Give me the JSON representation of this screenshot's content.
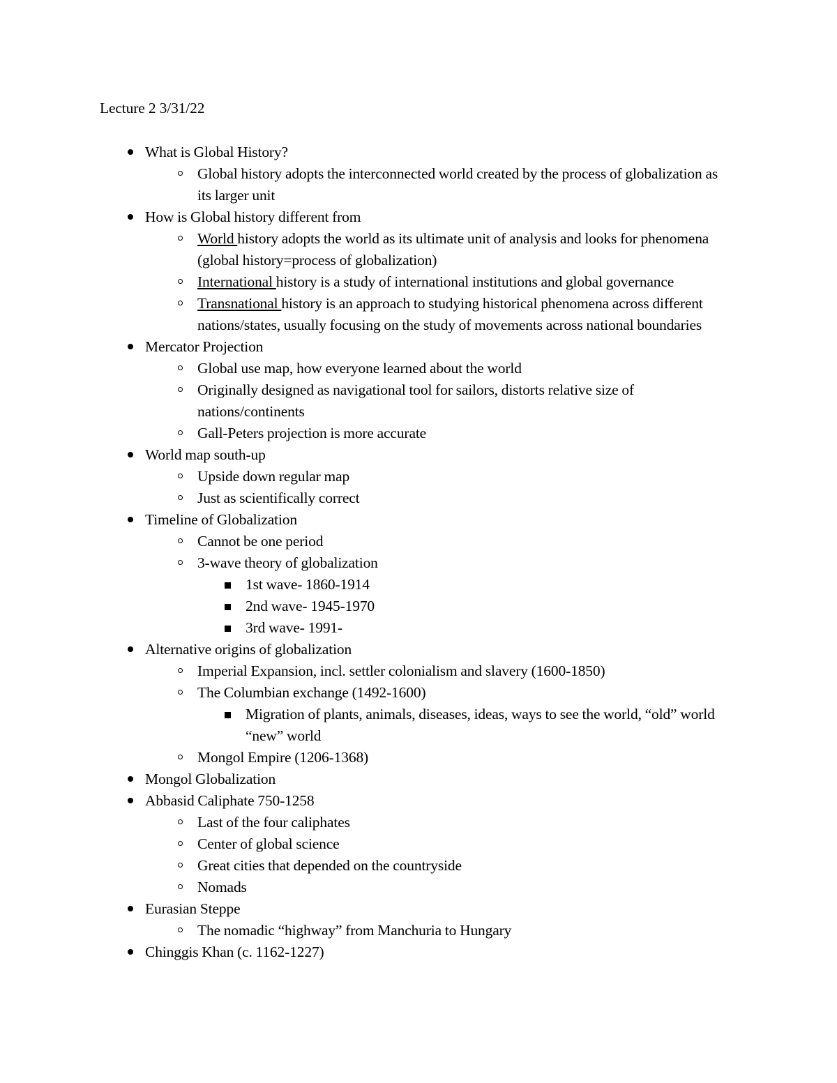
{
  "document": {
    "header": "Lecture 2 3/31/22",
    "outline": [
      {
        "level": 1,
        "bullet": "disc-bullet",
        "text": "What is Global History?"
      },
      {
        "level": 2,
        "bullet": "circle-bullet",
        "text": "Global history adopts the interconnected world created by the process of globalization as its larger unit"
      },
      {
        "level": 1,
        "bullet": "disc-bullet",
        "text": "How is Global history different from"
      },
      {
        "level": 2,
        "bullet": "circle-bullet",
        "underline_prefix": "World ",
        "text": "history adopts the world as its ultimate unit of analysis and looks for phenomena (global history=process of globalization)"
      },
      {
        "level": 2,
        "bullet": "circle-bullet",
        "underline_prefix": "International ",
        "text": "history is a study of international institutions and global governance"
      },
      {
        "level": 2,
        "bullet": "circle-bullet",
        "underline_prefix": "Transnational ",
        "text": "history is an approach to studying historical phenomena across different nations/states, usually focusing on the study of movements across national boundaries"
      },
      {
        "level": 1,
        "bullet": "disc-bullet",
        "text": "Mercator Projection"
      },
      {
        "level": 2,
        "bullet": "circle-bullet",
        "text": "Global use map, how everyone learned about the world"
      },
      {
        "level": 2,
        "bullet": "circle-bullet",
        "text": "Originally designed as navigational tool for sailors, distorts relative size of nations/continents"
      },
      {
        "level": 2,
        "bullet": "circle-bullet",
        "text": "Gall-Peters projection is more accurate"
      },
      {
        "level": 1,
        "bullet": "disc-bullet",
        "text": "World map south-up"
      },
      {
        "level": 2,
        "bullet": "circle-bullet",
        "text": "Upside down regular map"
      },
      {
        "level": 2,
        "bullet": "circle-bullet",
        "text": "Just as scientifically correct"
      },
      {
        "level": 1,
        "bullet": "disc-bullet",
        "text": "Timeline of Globalization"
      },
      {
        "level": 2,
        "bullet": "circle-bullet",
        "text": "Cannot be one period"
      },
      {
        "level": 2,
        "bullet": "circle-bullet",
        "text": "3-wave theory of globalization"
      },
      {
        "level": 3,
        "bullet": "square-bullet",
        "text": "1st wave- 1860-1914"
      },
      {
        "level": 3,
        "bullet": "square-bullet",
        "text": "2nd wave- 1945-1970"
      },
      {
        "level": 3,
        "bullet": "square-bullet",
        "text": "3rd wave- 1991-"
      },
      {
        "level": 1,
        "bullet": "disc-bullet",
        "text": "Alternative origins of globalization"
      },
      {
        "level": 2,
        "bullet": "circle-bullet",
        "text": "Imperial Expansion, incl. settler colonialism and slavery (1600-1850)"
      },
      {
        "level": 2,
        "bullet": "circle-bullet",
        "text": "The Columbian exchange (1492-1600)"
      },
      {
        "level": 3,
        "bullet": "square-bullet",
        "text": "Migration of plants, animals, diseases, ideas, ways to see the world, “old” world “new” world"
      },
      {
        "level": 2,
        "bullet": "circle-bullet",
        "text": "Mongol Empire (1206-1368)"
      },
      {
        "level": 1,
        "bullet": "disc-bullet",
        "text": "Mongol Globalization"
      },
      {
        "level": 1,
        "bullet": "disc-bullet",
        "text": "Abbasid Caliphate 750-1258"
      },
      {
        "level": 2,
        "bullet": "circle-bullet",
        "text": "Last of the four caliphates"
      },
      {
        "level": 2,
        "bullet": "circle-bullet",
        "text": "Center of global science"
      },
      {
        "level": 2,
        "bullet": "circle-bullet",
        "text": "Great cities that depended on the countryside"
      },
      {
        "level": 2,
        "bullet": "circle-bullet",
        "text": "Nomads"
      },
      {
        "level": 1,
        "bullet": "disc-bullet",
        "text": "Eurasian Steppe"
      },
      {
        "level": 2,
        "bullet": "circle-bullet",
        "text": "The nomadic “highway” from Manchuria to Hungary"
      },
      {
        "level": 1,
        "bullet": "disc-bullet",
        "text": "Chinggis Khan (c. 1162-1227)"
      }
    ]
  },
  "colors": {
    "page_background": "#ffffff",
    "text": "#000000"
  }
}
